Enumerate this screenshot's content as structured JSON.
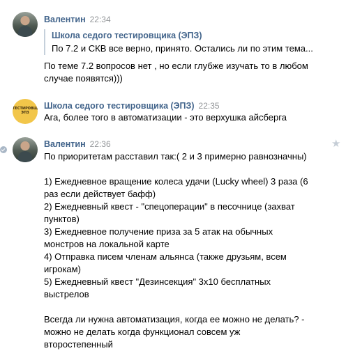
{
  "messages": [
    {
      "author": "Валентин",
      "time": "22:34",
      "quote_author": "Школа седого тестировщика (ЭПЗ)",
      "quote_text": "По 7.2 и СКВ все верно, принято. Остались ли по этим тема...",
      "text": "По теме 7.2 вопросов нет , но если глубже изучать то в любом\nслучае появятся)))"
    },
    {
      "author": "Школа седого тестировщика (ЭПЗ)",
      "time": "22:35",
      "avatar_label": "ТЕСТИРОВЩИК ЭПЗ",
      "text": "Ага, более того в автоматизации - это верхушка айсберга"
    },
    {
      "author": "Валентин",
      "time": "22:36",
      "text": "По приоритетам расставил так:( 2 и 3 примерно равнозначны)\n\n1) Ежедневное вращение колеса удачи (Lucky wheel) 3 раза (6\nраз если действует бафф)\n2) Ежедневный квест - \"спецоперации\" в песочнице (захват\nпунктов)\n3) Ежедневное получение приза за 5 атак на обычных\nмонстров на локальной карте\n4) Отправка писем членам альянса (также друзьям, всем\nигрокам)\n5) Ежедневный квест \"Дезинсекция\" 3х10 бесплатных\nвыстрелов\n\nВсегда ли нужна автоматизация, когда ее можно не делать? -\nможно не делать когда функционал совсем уж\nвторостепенный"
    }
  ]
}
